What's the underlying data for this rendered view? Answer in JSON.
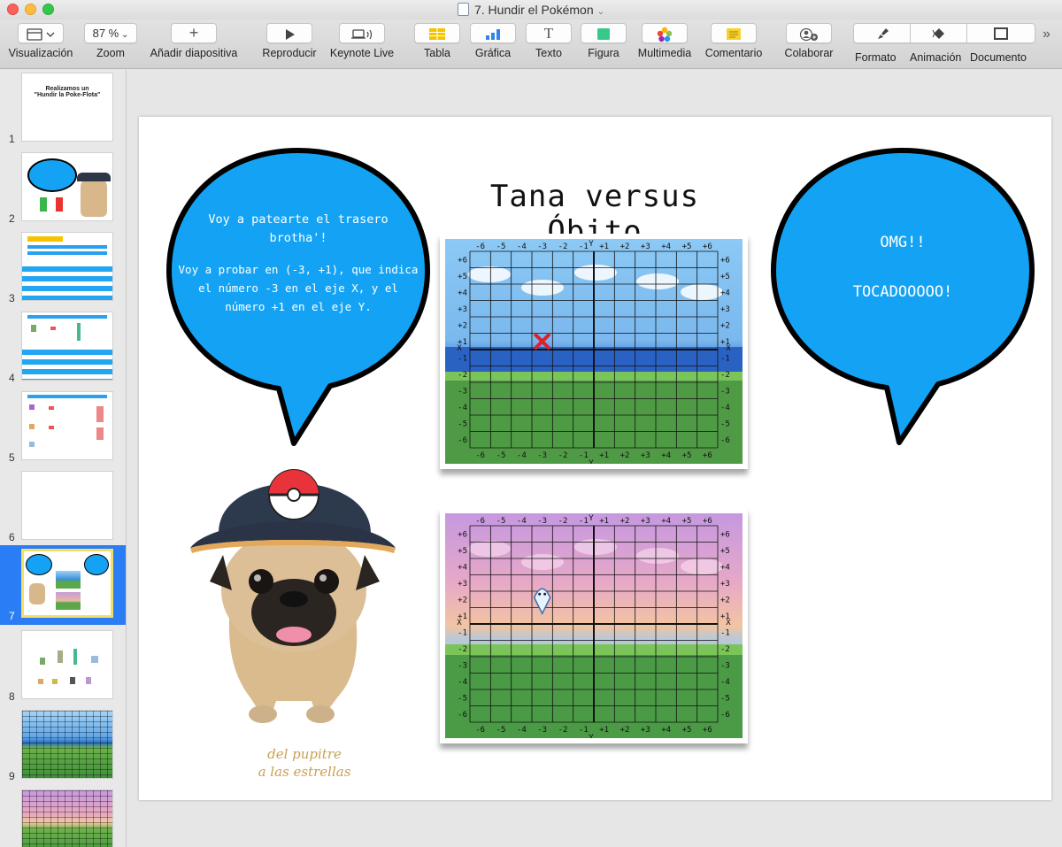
{
  "window": {
    "title": "7. Hundir el Pokémon"
  },
  "toolbar": {
    "view_label": "Visualización",
    "zoom_value": "87 %",
    "zoom_label": "Zoom",
    "add_slide_label": "Añadir diapositiva",
    "play_label": "Reproducir",
    "keynote_live_label": "Keynote Live",
    "table_label": "Tabla",
    "chart_label": "Gráfica",
    "text_label": "Texto",
    "shape_label": "Figura",
    "media_label": "Multimedia",
    "comment_label": "Comentario",
    "collaborate_label": "Colaborar",
    "format_label": "Formato",
    "animate_label": "Animación",
    "document_label": "Documento",
    "overflow_icon": "double-chevron-right-icon"
  },
  "sidebar": {
    "slides": [
      {
        "number": "1",
        "preview_title": "Realizamos un\n\"Hundir la Poke-Flota\""
      },
      {
        "number": "2"
      },
      {
        "number": "3"
      },
      {
        "number": "4"
      },
      {
        "number": "5"
      },
      {
        "number": "6"
      },
      {
        "number": "7",
        "selected": true
      },
      {
        "number": "8"
      },
      {
        "number": "9"
      },
      {
        "number": ""
      }
    ]
  },
  "slide": {
    "title": "Tana versus Óbito",
    "left_bubble": {
      "line1": "Voy a patearte el trasero",
      "line2": "brotha'!",
      "line3": "Voy a probar en (-3, +1), que indica",
      "line4": "el número -3 en el eje X, y el",
      "line5": "número +1 en el eje Y."
    },
    "right_bubble": {
      "line1": "OMG!!",
      "line2": "TOCADOOOOO!"
    },
    "signature": {
      "line1": "del pupitre",
      "line2": "a las estrellas"
    },
    "grid": {
      "x_ticks": [
        "-6",
        "-5",
        "-4",
        "-3",
        "-2",
        "-1",
        "+1",
        "+2",
        "+3",
        "+4",
        "+5",
        "+6"
      ],
      "y_ticks": [
        "+6",
        "+5",
        "+4",
        "+3",
        "+2",
        "+1",
        "-1",
        "-2",
        "-3",
        "-4",
        "-5",
        "-6"
      ],
      "x_axis": "X",
      "y_axis": "Y",
      "top_marker": {
        "x": -3,
        "y": 1,
        "type": "miss-cross"
      },
      "bottom_marker": {
        "x": -3,
        "y": 2,
        "type": "pokemon-sprite"
      }
    },
    "colors": {
      "bubble": "#14a3f4",
      "bubble_outline": "#000000",
      "selection": "#2a7df5",
      "marker": "#e0202a"
    }
  }
}
